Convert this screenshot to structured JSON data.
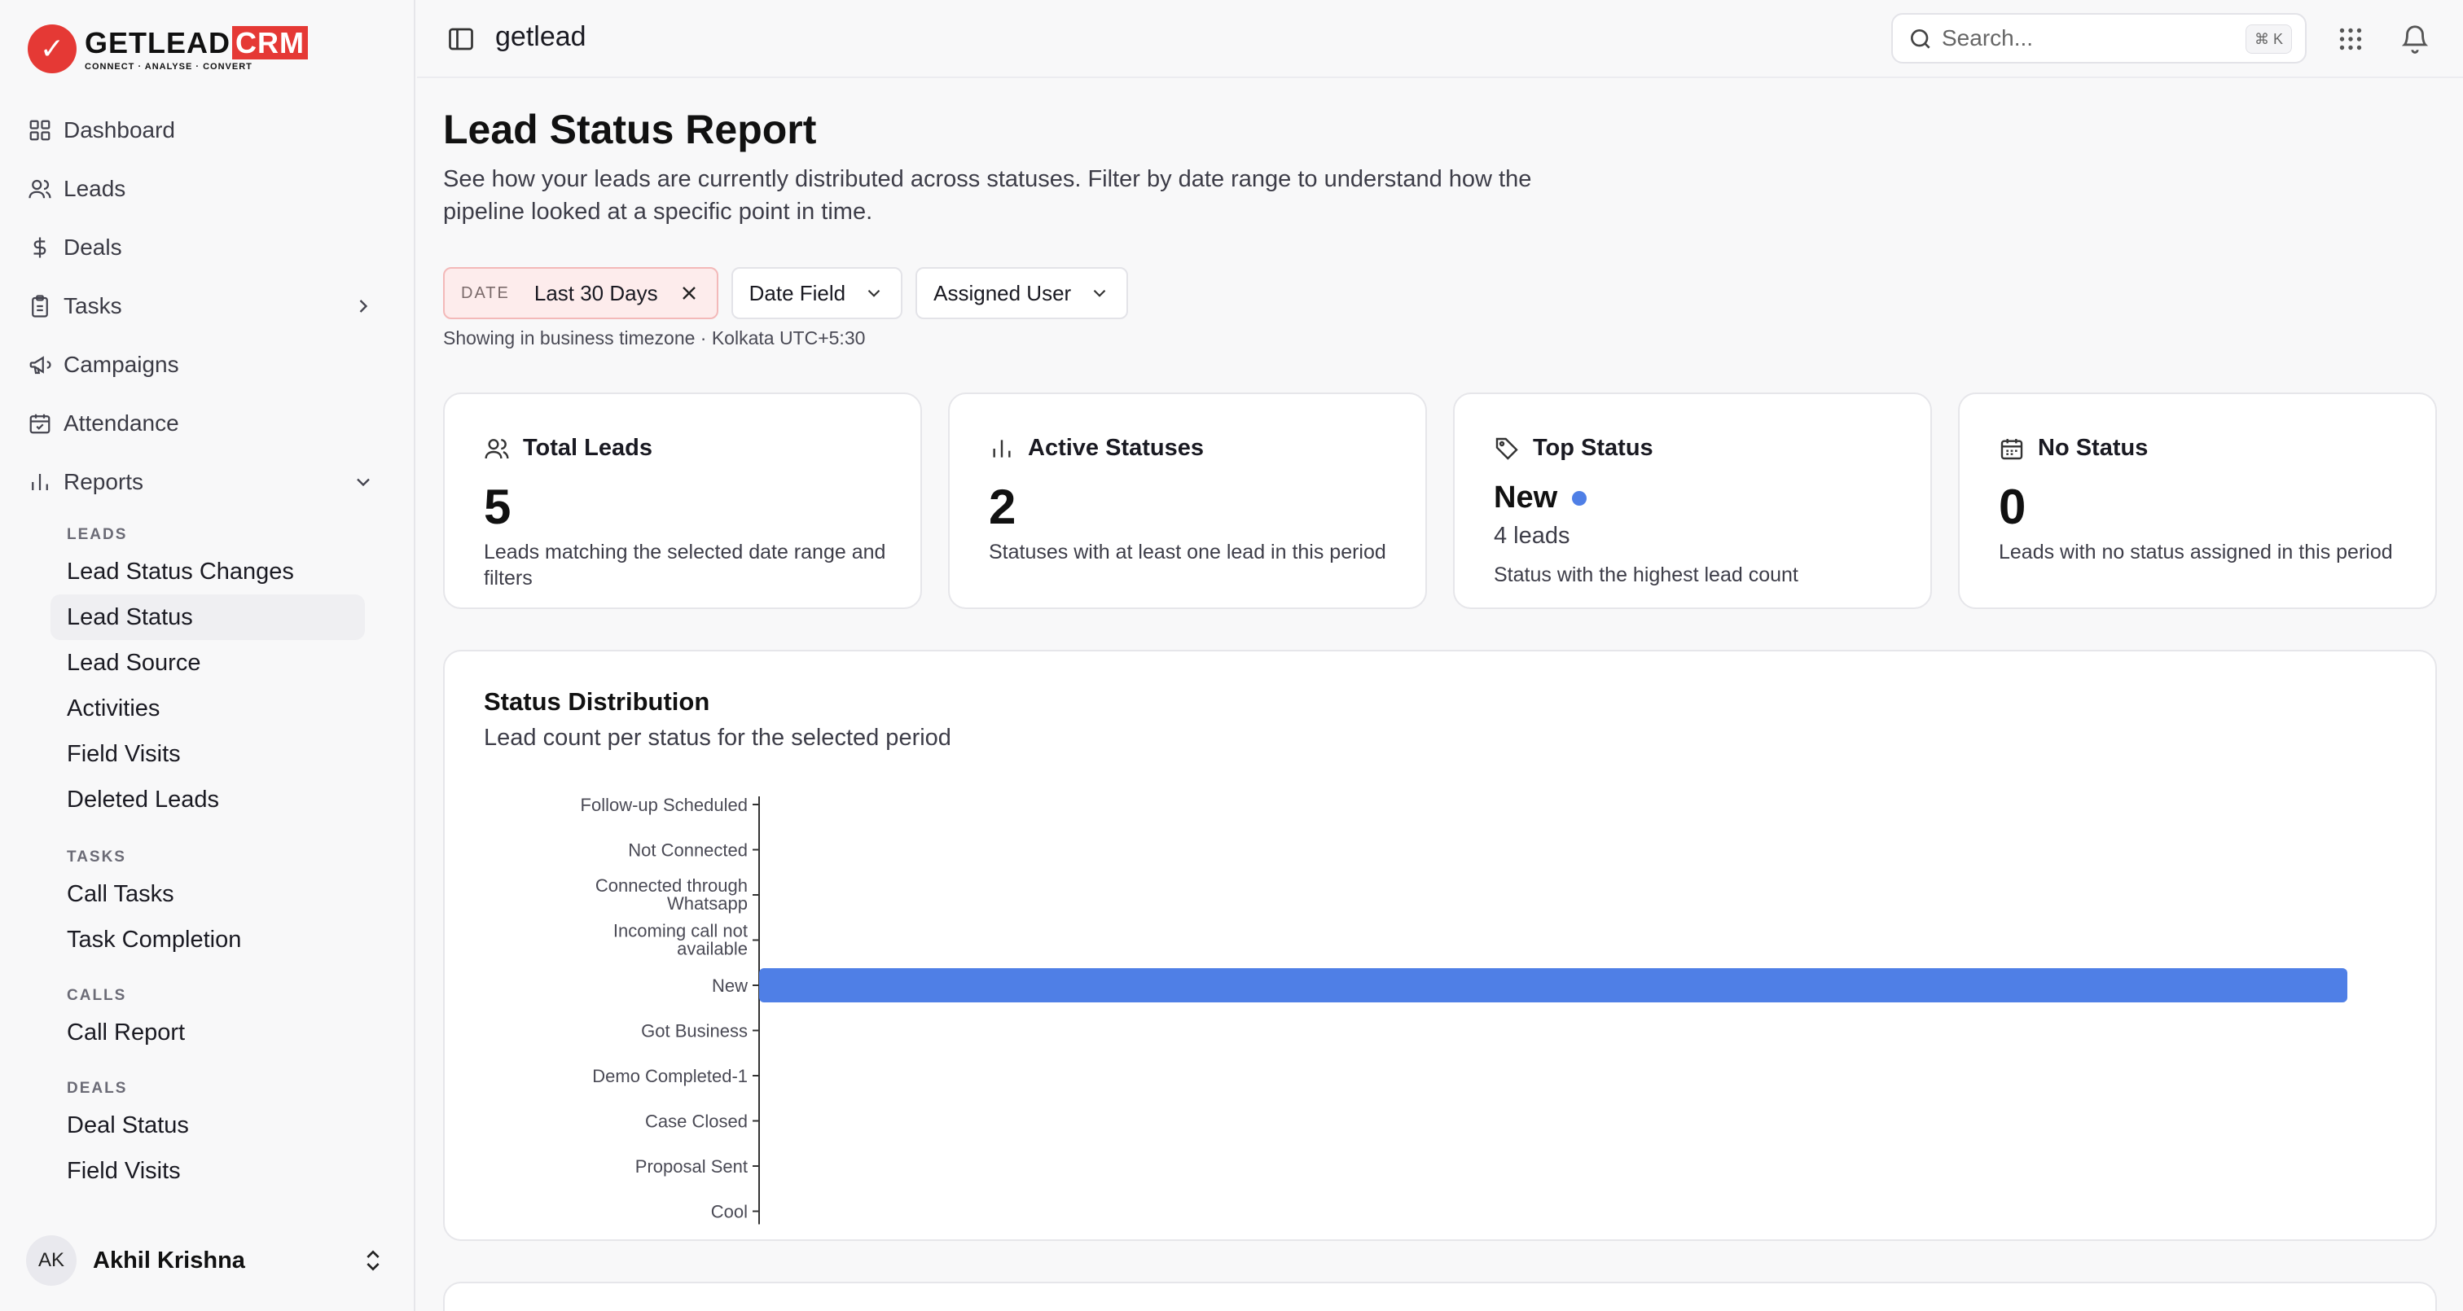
{
  "brand": {
    "logo_mark": "✓",
    "name": "GETLEAD",
    "name_suffix": "CRM",
    "tagline": "CONNECT · ANALYSE · CONVERT"
  },
  "sidebar": {
    "items": [
      {
        "label": "Dashboard",
        "icon": "dashboard-icon"
      },
      {
        "label": "Leads",
        "icon": "users-icon"
      },
      {
        "label": "Deals",
        "icon": "dollar-icon"
      },
      {
        "label": "Tasks",
        "icon": "clipboard-icon"
      },
      {
        "label": "Campaigns",
        "icon": "megaphone-icon"
      },
      {
        "label": "Attendance",
        "icon": "calendar-check-icon"
      },
      {
        "label": "Reports",
        "icon": "bar-chart-icon"
      }
    ],
    "groups": [
      {
        "heading": "LEADS",
        "items": [
          "Lead Status Changes",
          "Lead Status",
          "Lead Source",
          "Activities",
          "Field Visits",
          "Deleted Leads"
        ]
      },
      {
        "heading": "TASKS",
        "items": [
          "Call Tasks",
          "Task Completion"
        ]
      },
      {
        "heading": "CALLS",
        "items": [
          "Call Report"
        ]
      },
      {
        "heading": "DEALS",
        "items": [
          "Deal Status",
          "Field Visits"
        ]
      }
    ],
    "active_item": "Lead Status",
    "user": {
      "initials": "AK",
      "name": "Akhil Krishna"
    }
  },
  "topbar": {
    "workspace": "getlead",
    "search_placeholder": "Search...",
    "search_shortcut": "⌘ K"
  },
  "page": {
    "title": "Lead Status Report",
    "description": "See how your leads are currently distributed across statuses. Filter by date range to understand how the pipeline looked at a specific point in time.",
    "filters": {
      "date_label": "DATE",
      "date_value": "Last 30 Days",
      "date_field": "Date Field",
      "assigned_user": "Assigned User"
    },
    "timezone_note": "Showing in business timezone · Kolkata UTC+5:30"
  },
  "cards": {
    "total": {
      "title": "Total Leads",
      "value": "5",
      "desc": "Leads matching the selected date range and filters"
    },
    "active": {
      "title": "Active Statuses",
      "value": "2",
      "desc": "Statuses with at least one lead in this period"
    },
    "top": {
      "title": "Top Status",
      "value": "New",
      "count": "4 leads",
      "desc": "Status with the highest lead count",
      "dot_color": "#4f7fe6"
    },
    "none": {
      "title": "No Status",
      "value": "0",
      "desc": "Leads with no status assigned in this period"
    }
  },
  "chart_section": {
    "title": "Status Distribution",
    "subtitle": "Lead count per status for the selected period"
  },
  "chart_data": {
    "type": "bar",
    "orientation": "horizontal",
    "categories": [
      "Follow-up Scheduled",
      "Not Connected",
      "Connected through Whatsapp",
      "Incoming call not available",
      "New",
      "Got Business",
      "Demo Completed-1",
      "Case Closed",
      "Proposal Sent",
      "Cool"
    ],
    "values": [
      0,
      0,
      0,
      0,
      4,
      0,
      0,
      0,
      0,
      0
    ],
    "xlim": [
      0,
      4
    ],
    "bar_color": "#4f7fe6",
    "grid": false
  }
}
